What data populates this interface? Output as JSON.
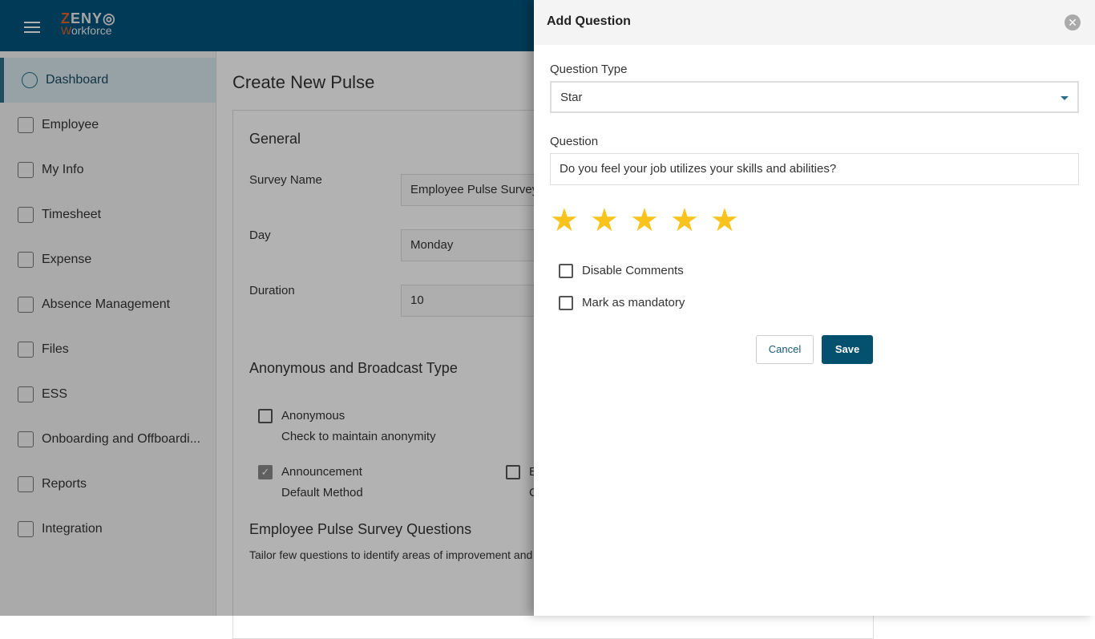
{
  "header": {
    "logo_top": "ZENY",
    "logo_bottom": "Workforce"
  },
  "sidebar": {
    "items": [
      {
        "label": "Dashboard",
        "icon": "dashboard-icon"
      },
      {
        "label": "Employee",
        "icon": "employee-icon"
      },
      {
        "label": "My Info",
        "icon": "my-info-icon"
      },
      {
        "label": "Timesheet",
        "icon": "clock-icon"
      },
      {
        "label": "Expense",
        "icon": "expense-icon"
      },
      {
        "label": "Absence Management",
        "icon": "door-icon"
      },
      {
        "label": "Files",
        "icon": "file-icon"
      },
      {
        "label": "ESS",
        "icon": "ess-icon"
      },
      {
        "label": "Onboarding and Offboardi...",
        "icon": "id-card-icon"
      },
      {
        "label": "Reports",
        "icon": "report-icon"
      },
      {
        "label": "Integration",
        "icon": "integration-icon"
      }
    ]
  },
  "main": {
    "title": "Create New Pulse",
    "general": "General",
    "survey_name_label": "Survey Name",
    "survey_name_value": "Employee Pulse Survey",
    "day_label": "Day",
    "day_value": "Monday",
    "duration_label": "Duration",
    "duration_value": "10",
    "broadcast_title": "Anonymous and Broadcast Type",
    "anonymous_label": "Anonymous",
    "anonymous_desc": "Check to maintain anonymity",
    "anonymous_checked": false,
    "announcement_label": "Announcement",
    "announcement_desc": "Default Method",
    "announcement_checked": true,
    "other_label": "E",
    "other_desc": "C",
    "questions_title": "Employee Pulse Survey Questions",
    "questions_desc": "Tailor few questions to identify areas of improvement and"
  },
  "panel": {
    "title": "Add Question",
    "type_label": "Question Type",
    "type_value": "Star",
    "question_label": "Question",
    "question_value": "Do you feel your job utilizes your skills and abilities?",
    "stars": 5,
    "star_color": "#f7c31c",
    "disable_comments": "Disable Comments",
    "mandatory": "Mark as mandatory",
    "cancel": "Cancel",
    "save": "Save"
  }
}
